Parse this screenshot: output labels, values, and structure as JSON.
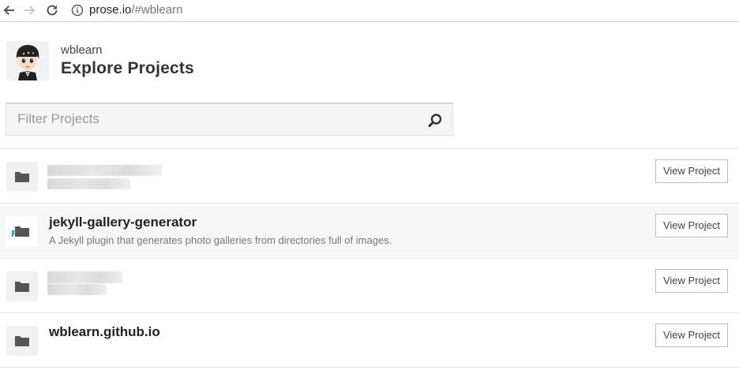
{
  "browser": {
    "url_host": "prose.io",
    "url_path": "/#wblearn",
    "back_icon": "back-arrow-icon",
    "forward_icon": "forward-arrow-icon",
    "reload_icon": "reload-icon",
    "info_icon": "info-circle-icon"
  },
  "header": {
    "owner": "wblearn",
    "title": "Explore Projects"
  },
  "search": {
    "placeholder": "Filter Projects",
    "value": "",
    "icon": "search-icon"
  },
  "projects": [
    {
      "name": "",
      "description": "",
      "redacted": true,
      "icon": "folder-icon",
      "button_label": "View Project"
    },
    {
      "name": "jekyll-gallery-generator",
      "description": "A Jekyll plugin that generates photo galleries from directories full of images.",
      "redacted": false,
      "icon": "forked-folder-icon",
      "button_label": "View Project"
    },
    {
      "name": "",
      "description": "",
      "redacted": true,
      "icon": "folder-icon",
      "button_label": "View Project"
    },
    {
      "name": "wblearn.github.io",
      "description": "",
      "redacted": false,
      "icon": "folder-icon",
      "button_label": "View Project"
    }
  ],
  "colors": {
    "accent_teal": "#2a9bb0",
    "row_alt_bg": "#f7f7f7",
    "border": "#e6e6e6"
  }
}
